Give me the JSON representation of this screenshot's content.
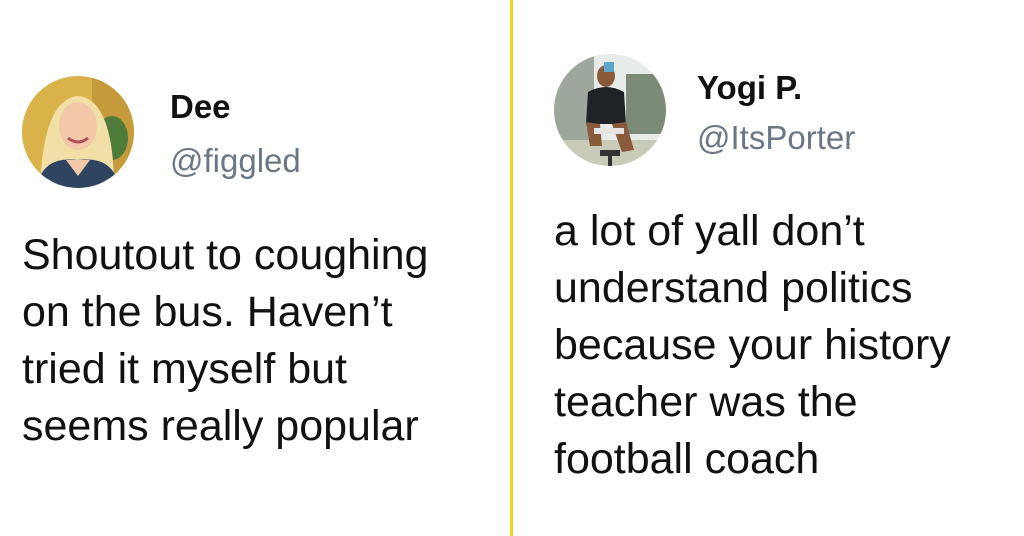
{
  "divider_color": "#e8dc10",
  "tweets": [
    {
      "name": "Dee",
      "handle": "@figgled",
      "lines": [
        "Shoutout to coughing",
        "on the bus. Haven’t",
        "tried it myself but",
        "seems really popular"
      ]
    },
    {
      "name": "Yogi P.",
      "handle": "@ItsPorter",
      "lines": [
        "a lot of yall don’t",
        "understand politics",
        "because your history",
        "teacher was the",
        "football coach"
      ]
    }
  ]
}
